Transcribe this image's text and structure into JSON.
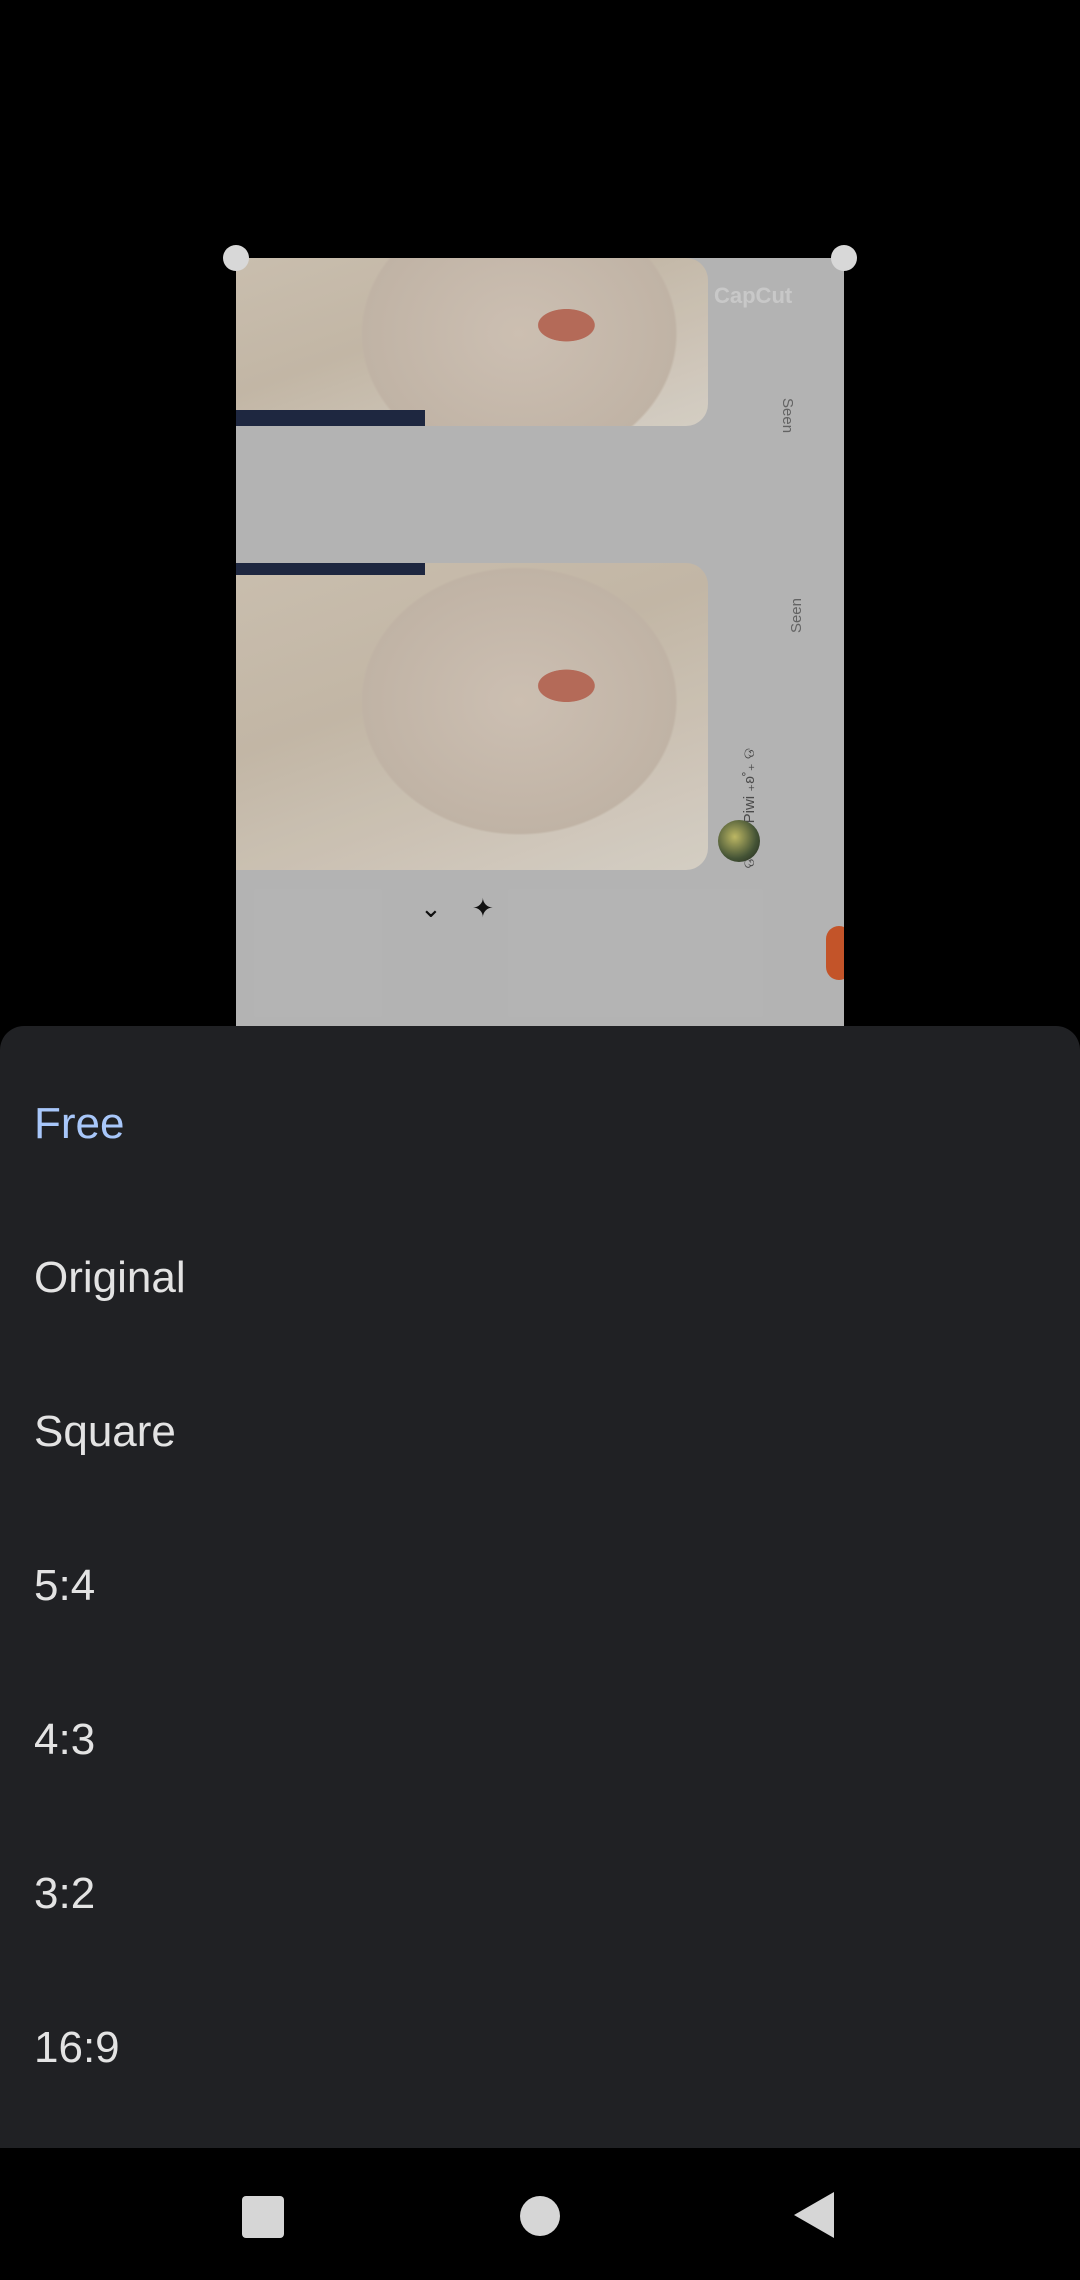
{
  "preview": {
    "seen_label_1": "Seen",
    "seen_label_2": "Seen",
    "username": "ଡ ₊˚ʚ₊ Piwi ₊ʚ˚₊ ଡ",
    "watermark": "CapCut"
  },
  "aspect_options": [
    {
      "label": "Free",
      "selected": true
    },
    {
      "label": "Original",
      "selected": false
    },
    {
      "label": "Square",
      "selected": false
    },
    {
      "label": "5:4",
      "selected": false
    },
    {
      "label": "4:3",
      "selected": false
    },
    {
      "label": "3:2",
      "selected": false
    },
    {
      "label": "16:9",
      "selected": false
    }
  ],
  "colors": {
    "sheet_background": "#202124",
    "selected_option": "#a8c7fa",
    "option_text": "#e3e3e3"
  },
  "icons": {
    "nav_recent": "square-icon",
    "nav_home": "circle-icon",
    "nav_back": "triangle-back-icon"
  }
}
